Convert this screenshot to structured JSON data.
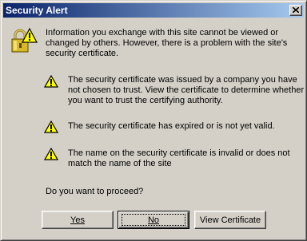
{
  "window": {
    "title": "Security Alert"
  },
  "dialog": {
    "intro_line1": "Information you exchange with this site cannot be viewed or",
    "intro_line2": "changed by others. However, there is a problem with the site's",
    "intro_line3": "security certificate.",
    "warnings": [
      {
        "line1": "The security certificate was issued by a company you have",
        "line2": "not chosen to trust. View the certificate to determine whether",
        "line3": "you want to trust the certifying authority."
      },
      {
        "line1": "The security certificate has expired or is not yet valid."
      },
      {
        "line1": "The name on the security certificate is invalid or does not",
        "line2": "match the name of the site"
      }
    ],
    "question": "Do you want to proceed?"
  },
  "buttons": {
    "yes": "Yes",
    "no": "No",
    "view_certificate": "View Certificate"
  },
  "icons": {
    "lock": "padlock-warning-icon",
    "warning": "warning-triangle-icon",
    "close": "close-icon"
  },
  "colors": {
    "face": "#d4d0c8",
    "title_start": "#0a246a",
    "title_end": "#a6caf0",
    "warning_yellow": "#ffff00"
  }
}
